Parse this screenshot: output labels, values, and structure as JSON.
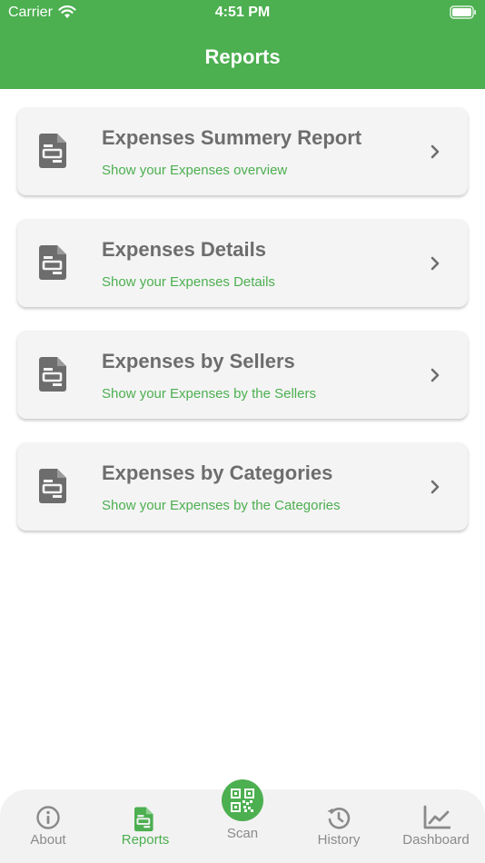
{
  "status_bar": {
    "carrier": "Carrier",
    "time": "4:51 PM"
  },
  "header": {
    "title": "Reports"
  },
  "reports": [
    {
      "title": "Expenses Summery Report",
      "subtitle": "Show your Expenses overview",
      "icon": "document-icon"
    },
    {
      "title": "Expenses Details",
      "subtitle": "Show your Expenses Details",
      "icon": "document-icon"
    },
    {
      "title": "Expenses by Sellers",
      "subtitle": "Show your Expenses by the Sellers",
      "icon": "document-icon"
    },
    {
      "title": "Expenses by Categories",
      "subtitle": "Show your Expenses by the Categories",
      "icon": "document-icon"
    }
  ],
  "tabs": {
    "about": "About",
    "reports": "Reports",
    "scan": "Scan",
    "history": "History",
    "dashboard": "Dashboard",
    "active": "reports"
  },
  "colors": {
    "accent": "#4caf50",
    "card_background": "#f4f4f4",
    "title_text": "#6d6d6d",
    "inactive_tab": "#8a8a8a"
  }
}
